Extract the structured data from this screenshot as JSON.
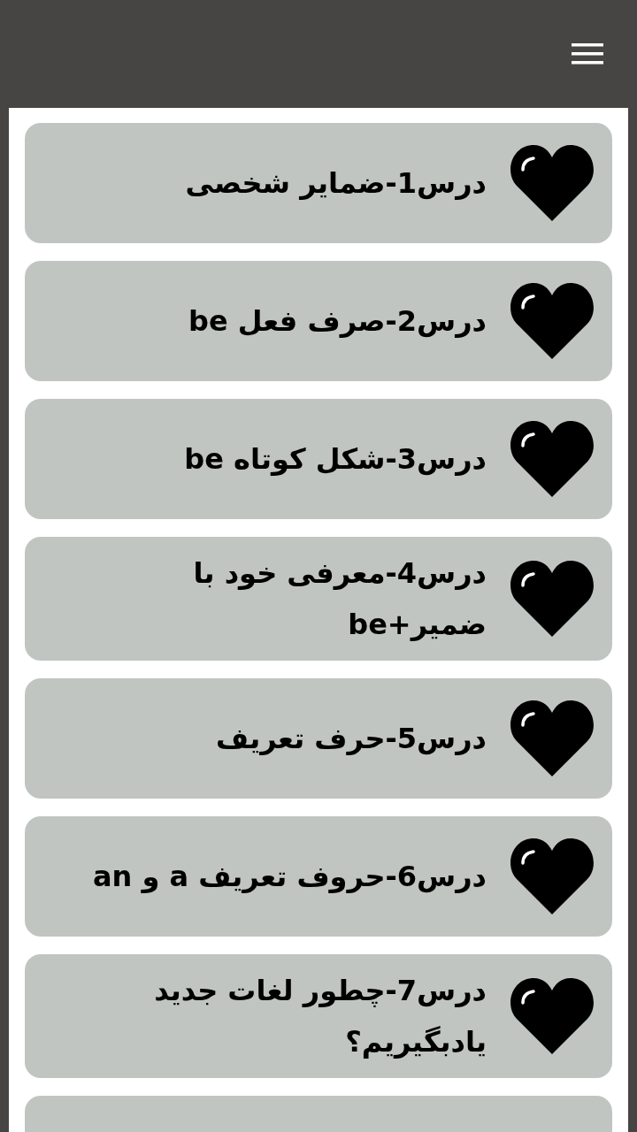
{
  "lessons": [
    {
      "title": "درس1-ضمایر شخصی"
    },
    {
      "title": "درس2-صرف فعل be"
    },
    {
      "title": "درس3-شکل کوتاه be"
    },
    {
      "title": "درس4-معرفی خود با ضمیر+be"
    },
    {
      "title": "درس5-حرف تعریف"
    },
    {
      "title": "درس6-حروف تعریف a و an"
    },
    {
      "title": "درس7-چطور لغات جدید یادبگیریم؟"
    }
  ]
}
